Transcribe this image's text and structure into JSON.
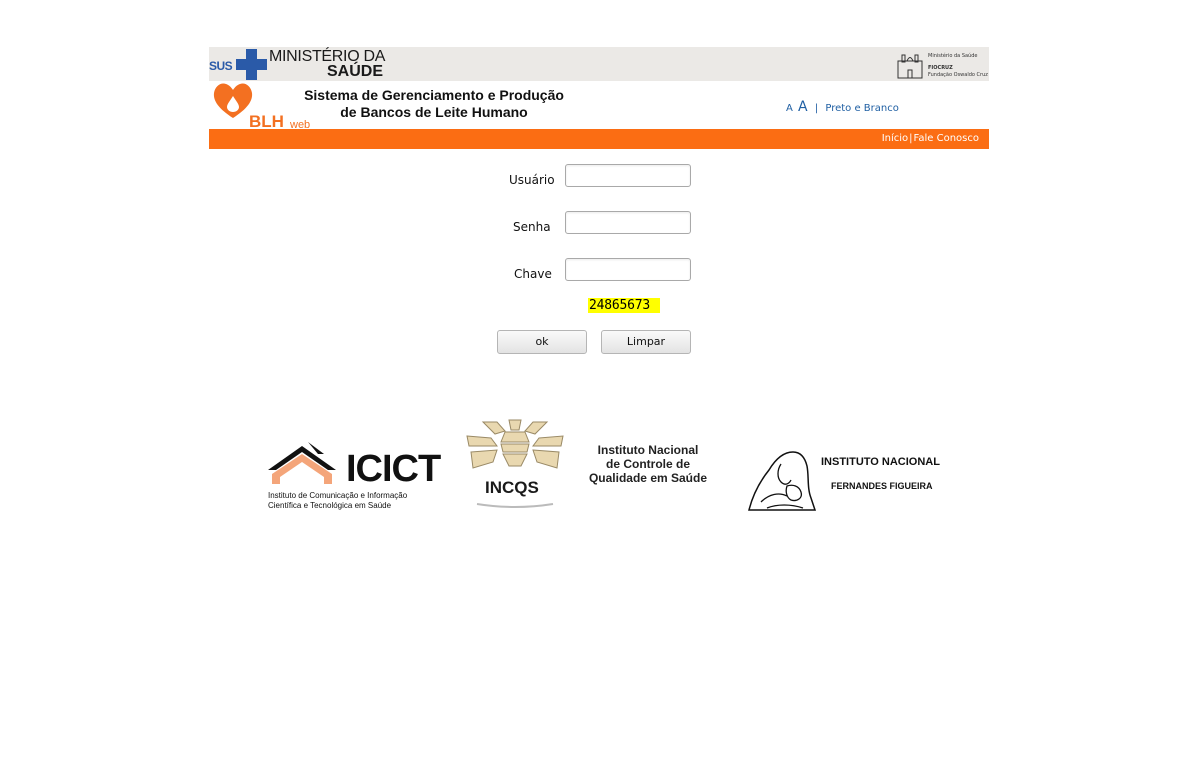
{
  "gov_header": {
    "sus_label": "SUS",
    "ministerio_line1": "MINISTÉRIO DA",
    "ministerio_line2": "SAÚDE",
    "fiocruz_line1": "Ministério da Saúde",
    "fiocruz_line2": "FIOCRUZ",
    "fiocruz_line3": "Fundação Oswaldo Cruz"
  },
  "app_header": {
    "logo_name": "BLH",
    "logo_suffix": "web",
    "title_line1": "Sistema de Gerenciamento e Produção",
    "title_line2": "de Bancos de Leite Humano",
    "font_small": "A",
    "font_large": "A",
    "separator": "|",
    "contrast_link": "Preto e Branco"
  },
  "nav": {
    "home": "Início",
    "separator": "|",
    "contact": "Fale Conosco",
    "bar_color": "#fb6d13"
  },
  "login_form": {
    "user_label": "Usuário",
    "user_value": "",
    "password_label": "Senha",
    "password_value": "",
    "key_label": "Chave",
    "key_value": "",
    "captcha_code": "24865673",
    "ok_button": "ok",
    "clear_button": "Limpar"
  },
  "partners": {
    "icict_name": "ICICT",
    "icict_sub_line1": "Instituto de Comunicação e Informação",
    "icict_sub_line2": "Científica e Tecnológica em Saúde",
    "incqs_name": "INCQS",
    "incqs_full_line1": "Instituto Nacional",
    "incqs_full_line2": "de Controle de",
    "incqs_full_line3": "Qualidade em Saúde",
    "iff_line1": "INSTITUTO NACIONAL",
    "iff_line2": "FERNANDES FIGUEIRA"
  },
  "colors": {
    "orange": "#fb6d13",
    "link_blue": "#1f5fa3",
    "sus_blue": "#2a5aa8",
    "captcha_bg": "#ffff00"
  }
}
